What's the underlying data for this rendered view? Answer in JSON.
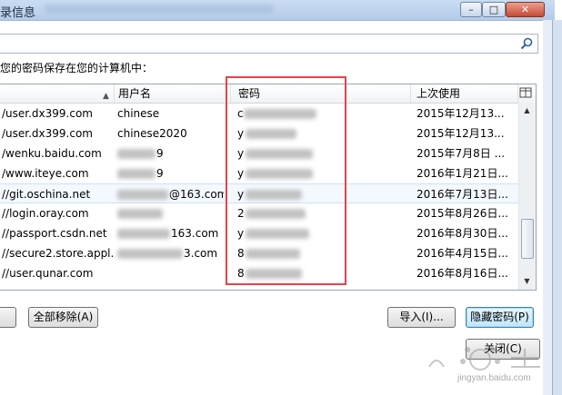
{
  "window": {
    "title": "录信息"
  },
  "search": {
    "value": "",
    "placeholder": ""
  },
  "caption": "您的密码保存在您的计算机中：",
  "columns": {
    "site": "",
    "username": "用户名",
    "password": "密码",
    "last_used": "上次使用"
  },
  "rows": [
    {
      "site": "/user.dx399.com",
      "username": "chinese",
      "password": "c",
      "last_used": "2015年12月13..."
    },
    {
      "site": "/user.dx399.com",
      "username": "chinese2020",
      "password": "y",
      "last_used": "2015年12月13..."
    },
    {
      "site": "/wenku.baidu.com",
      "username": "9",
      "password": "y",
      "last_used": "2015年7月8日 ..."
    },
    {
      "site": "/www.iteye.com",
      "username": "9",
      "password": "y",
      "last_used": "2016年1月21日..."
    },
    {
      "site": "//git.oschina.net",
      "username": "@163.com",
      "password": "y",
      "last_used": "2016年7月13日..."
    },
    {
      "site": "//login.oray.com",
      "username": "",
      "password": "2",
      "last_used": "2015年8月26日..."
    },
    {
      "site": "//passport.csdn.net",
      "username": "163.com",
      "password": "y",
      "last_used": "2016年8月30日..."
    },
    {
      "site": "//secure2.store.appl...",
      "username": "3.com",
      "password": "8",
      "last_used": "2016年4月15日..."
    },
    {
      "site": "//user.qunar.com",
      "username": "",
      "password": "8",
      "last_used": "2016年8月16日..."
    }
  ],
  "buttons": {
    "remove_all": "全部移除(A)",
    "import": "导入(I)...",
    "hide_passwords": "隐藏密码(P)",
    "close": "关闭(C)"
  },
  "watermark": {
    "url": "jingyan.baidu.com"
  },
  "colors": {
    "highlight": "#e8414c",
    "accent": "#3c7fb1"
  }
}
